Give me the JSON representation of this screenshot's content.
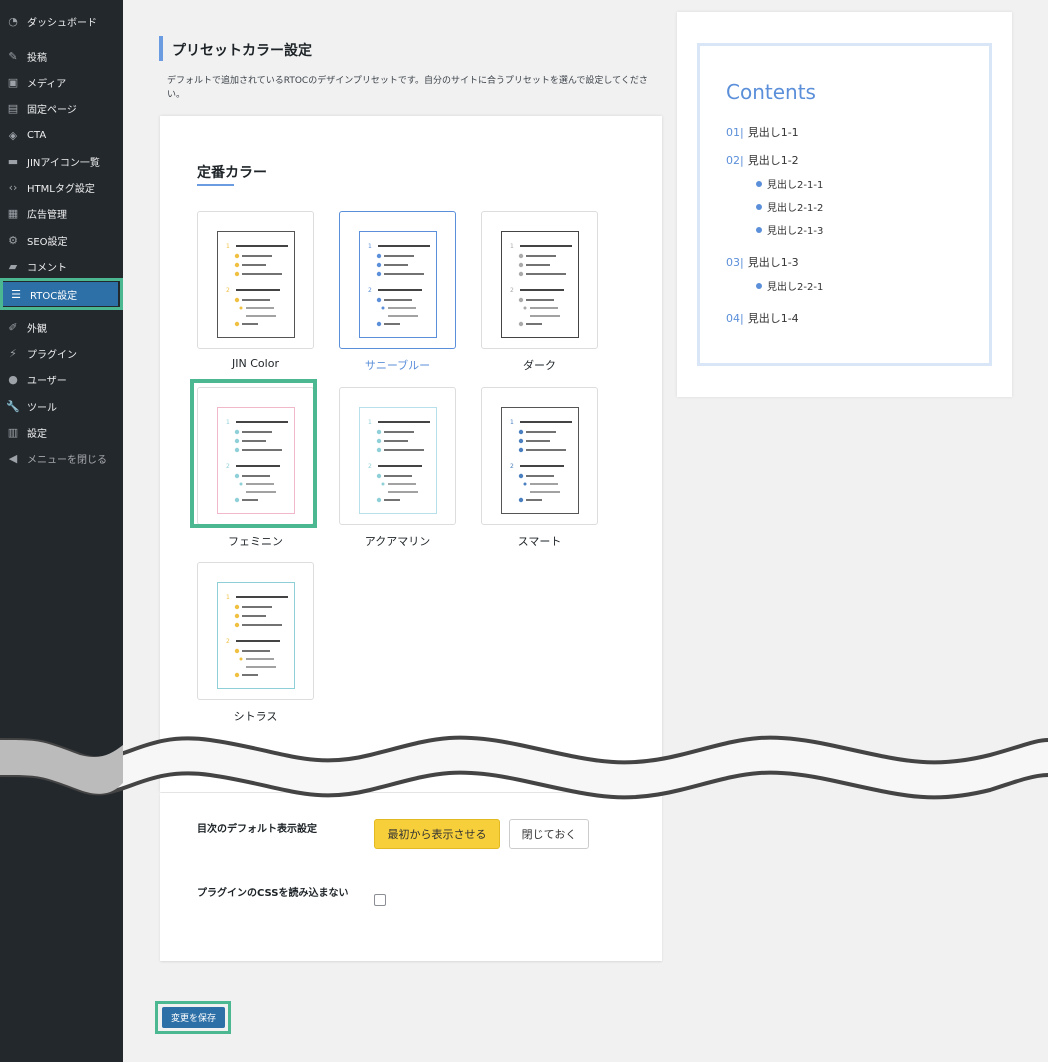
{
  "sidebar": {
    "items": [
      {
        "label": "ダッシュボード",
        "icon": "dashboard-icon"
      },
      {
        "label": "投稿",
        "icon": "pin-icon"
      },
      {
        "label": "メディア",
        "icon": "media-icon"
      },
      {
        "label": "固定ページ",
        "icon": "page-icon"
      },
      {
        "label": "CTA",
        "icon": "tag-icon"
      },
      {
        "label": "JINアイコン一覧",
        "icon": "list-icon"
      },
      {
        "label": "HTMLタグ設定",
        "icon": "code-icon"
      },
      {
        "label": "広告管理",
        "icon": "ad-icon"
      },
      {
        "label": "SEO設定",
        "icon": "gear-icon"
      },
      {
        "label": "コメント",
        "icon": "comment-icon"
      },
      {
        "label": "RTOC設定",
        "icon": "list-icon"
      },
      {
        "label": "外観",
        "icon": "brush-icon"
      },
      {
        "label": "プラグイン",
        "icon": "plugin-icon"
      },
      {
        "label": "ユーザー",
        "icon": "user-icon"
      },
      {
        "label": "ツール",
        "icon": "wrench-icon"
      },
      {
        "label": "設定",
        "icon": "settings-icon"
      },
      {
        "label": "メニューを閉じる",
        "icon": "collapse-icon"
      }
    ]
  },
  "section": {
    "title": "プリセットカラー設定",
    "description": "デフォルトで追加されているRTOCのデザインプリセットです。自分のサイトに合うプリセットを選んで設定してください。"
  },
  "card": {
    "title": "定番カラー"
  },
  "presets": [
    {
      "label": "JIN Color",
      "accent": "#f0c040"
    },
    {
      "label": "サニーブルー",
      "accent": "#5b8fd9"
    },
    {
      "label": "ダーク",
      "accent": "#aaaaaa"
    },
    {
      "label": "フェミニン",
      "accent": "#8fd0d8"
    },
    {
      "label": "アクアマリン",
      "accent": "#8fd0d8"
    },
    {
      "label": "スマート",
      "accent": "#4a7fc0"
    },
    {
      "label": "シトラス",
      "accent": "#f0c040"
    }
  ],
  "toc": {
    "title": "Contents",
    "h1": [
      {
        "num": "01|",
        "text": "見出し1-1"
      },
      {
        "num": "02|",
        "text": "見出し1-2"
      },
      {
        "num": "03|",
        "text": "見出し1-3"
      },
      {
        "num": "04|",
        "text": "見出し1-4"
      }
    ],
    "h2": [
      "見出し2-1-1",
      "見出し2-1-2",
      "見出し2-1-3",
      "見出し2-2-1"
    ]
  },
  "settings": {
    "default_display_label": "目次のデフォルト表示設定",
    "show_button": "最初から表示させる",
    "hide_button": "閉じておく",
    "css_label": "プラグインのCSSを読み込まない"
  },
  "save_button": "変更を保存"
}
